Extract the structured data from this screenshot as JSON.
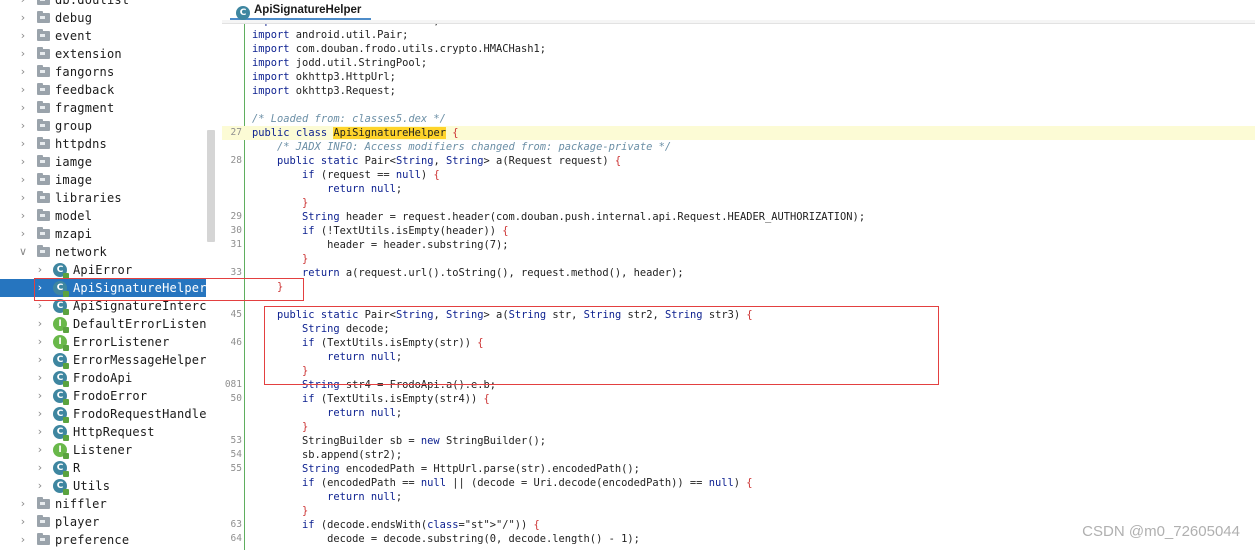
{
  "tree": {
    "items": [
      {
        "label": "db.doulist",
        "type": "package",
        "expand": "collapsed",
        "depth": 0
      },
      {
        "label": "debug",
        "type": "package",
        "expand": "collapsed",
        "depth": 0
      },
      {
        "label": "event",
        "type": "package",
        "expand": "collapsed",
        "depth": 0
      },
      {
        "label": "extension",
        "type": "package",
        "expand": "collapsed",
        "depth": 0
      },
      {
        "label": "fangorns",
        "type": "package",
        "expand": "collapsed",
        "depth": 0
      },
      {
        "label": "feedback",
        "type": "package",
        "expand": "collapsed",
        "depth": 0
      },
      {
        "label": "fragment",
        "type": "package",
        "expand": "collapsed",
        "depth": 0
      },
      {
        "label": "group",
        "type": "package",
        "expand": "collapsed",
        "depth": 0
      },
      {
        "label": "httpdns",
        "type": "package",
        "expand": "collapsed",
        "depth": 0
      },
      {
        "label": "iamge",
        "type": "package",
        "expand": "collapsed",
        "depth": 0
      },
      {
        "label": "image",
        "type": "package",
        "expand": "collapsed",
        "depth": 0
      },
      {
        "label": "libraries",
        "type": "package",
        "expand": "collapsed",
        "depth": 0
      },
      {
        "label": "model",
        "type": "package",
        "expand": "collapsed",
        "depth": 0
      },
      {
        "label": "mzapi",
        "type": "package",
        "expand": "collapsed",
        "depth": 0
      },
      {
        "label": "network",
        "type": "package",
        "expand": "expanded",
        "depth": 0
      },
      {
        "label": "ApiError",
        "type": "class",
        "expand": "collapsed",
        "depth": 1
      },
      {
        "label": "ApiSignatureHelper",
        "type": "class",
        "expand": "collapsed",
        "depth": 1,
        "selected": true
      },
      {
        "label": "ApiSignatureInterce",
        "type": "class",
        "expand": "collapsed",
        "depth": 1
      },
      {
        "label": "DefaultErrorListene",
        "type": "interface",
        "expand": "collapsed",
        "depth": 1
      },
      {
        "label": "ErrorListener",
        "type": "interface",
        "expand": "collapsed",
        "depth": 1
      },
      {
        "label": "ErrorMessageHelper",
        "type": "class",
        "expand": "collapsed",
        "depth": 1
      },
      {
        "label": "FrodoApi",
        "type": "class",
        "expand": "collapsed",
        "depth": 1
      },
      {
        "label": "FrodoError",
        "type": "class",
        "expand": "collapsed",
        "depth": 1
      },
      {
        "label": "FrodoRequestHandler",
        "type": "class",
        "expand": "collapsed",
        "depth": 1
      },
      {
        "label": "HttpRequest",
        "type": "class",
        "expand": "collapsed",
        "depth": 1
      },
      {
        "label": "Listener",
        "type": "interface",
        "expand": "collapsed",
        "depth": 1
      },
      {
        "label": "R",
        "type": "class",
        "expand": "collapsed",
        "depth": 1
      },
      {
        "label": "Utils",
        "type": "class",
        "expand": "collapsed",
        "depth": 1
      },
      {
        "label": "niffler",
        "type": "package",
        "expand": "collapsed",
        "depth": 0
      },
      {
        "label": "player",
        "type": "package",
        "expand": "collapsed",
        "depth": 0
      },
      {
        "label": "preference",
        "type": "package",
        "expand": "collapsed",
        "depth": 0
      }
    ]
  },
  "editor": {
    "tab_label": "ApiSignatureHelper",
    "class_icon_letter": "C",
    "interface_icon_letter": "I",
    "lines": [
      {
        "num": "",
        "text": "import android.text.TextUtils;",
        "type": "import"
      },
      {
        "num": "",
        "text": "import android.util.Pair;",
        "type": "import"
      },
      {
        "num": "",
        "text": "import com.douban.frodo.utils.crypto.HMACHash1;",
        "type": "import"
      },
      {
        "num": "",
        "text": "import jodd.util.StringPool;",
        "type": "import"
      },
      {
        "num": "",
        "text": "import okhttp3.HttpUrl;",
        "type": "import"
      },
      {
        "num": "",
        "text": "import okhttp3.Request;",
        "type": "import"
      },
      {
        "num": "",
        "text": "",
        "type": "blank"
      },
      {
        "num": "",
        "text": "/* Loaded from: classes5.dex */",
        "type": "comment"
      },
      {
        "num": "27",
        "text": "public class ApiSignatureHelper {",
        "type": "classdecl"
      },
      {
        "num": "",
        "text": "    /* JADX INFO: Access modifiers changed from: package-private */",
        "type": "comment"
      },
      {
        "num": "28",
        "text": "    public static Pair<String, String> a(Request request) {",
        "type": "code"
      },
      {
        "num": "",
        "text": "        if (request == null) {",
        "type": "code"
      },
      {
        "num": "",
        "text": "            return null;",
        "type": "code"
      },
      {
        "num": "",
        "text": "        }",
        "type": "code"
      },
      {
        "num": "29",
        "text": "        String header = request.header(com.douban.push.internal.api.Request.HEADER_AUTHORIZATION);",
        "type": "code"
      },
      {
        "num": "30",
        "text": "        if (!TextUtils.isEmpty(header)) {",
        "type": "code"
      },
      {
        "num": "31",
        "text": "            header = header.substring(7);",
        "type": "code"
      },
      {
        "num": "",
        "text": "        }",
        "type": "code"
      },
      {
        "num": "33",
        "text": "        return a(request.url().toString(), request.method(), header);",
        "type": "code"
      },
      {
        "num": "",
        "text": "    }",
        "type": "code"
      },
      {
        "num": "",
        "text": "",
        "type": "blank"
      },
      {
        "num": "45",
        "text": "    public static Pair<String, String> a(String str, String str2, String str3) {",
        "type": "code"
      },
      {
        "num": "",
        "text": "        String decode;",
        "type": "code"
      },
      {
        "num": "46",
        "text": "        if (TextUtils.isEmpty(str)) {",
        "type": "code"
      },
      {
        "num": "",
        "text": "            return null;",
        "type": "code"
      },
      {
        "num": "",
        "text": "        }",
        "type": "code"
      },
      {
        "num": "081",
        "text": "        String str4 = FrodoApi.a().e.b;",
        "type": "code"
      },
      {
        "num": "50",
        "text": "        if (TextUtils.isEmpty(str4)) {",
        "type": "code"
      },
      {
        "num": "",
        "text": "            return null;",
        "type": "code"
      },
      {
        "num": "",
        "text": "        }",
        "type": "code"
      },
      {
        "num": "53",
        "text": "        StringBuilder sb = new StringBuilder();",
        "type": "code"
      },
      {
        "num": "54",
        "text": "        sb.append(str2);",
        "type": "code"
      },
      {
        "num": "55",
        "text": "        String encodedPath = HttpUrl.parse(str).encodedPath();",
        "type": "code"
      },
      {
        "num": "",
        "text": "        if (encodedPath == null || (decode = Uri.decode(encodedPath)) == null) {",
        "type": "code"
      },
      {
        "num": "",
        "text": "            return null;",
        "type": "code"
      },
      {
        "num": "",
        "text": "        }",
        "type": "code"
      },
      {
        "num": "63",
        "text": "        if (decode.endsWith(\"/\")) {",
        "type": "code"
      },
      {
        "num": "64",
        "text": "            decode = decode.substring(0, decode.length() - 1);",
        "type": "code"
      }
    ]
  },
  "watermark": "CSDN @m0_72605044",
  "colors": {
    "selection": "#2675bf",
    "annotation_red": "#e34040",
    "line_highlight": "#fcfbd5",
    "name_highlight": "#ffd42a",
    "keyword": "#0b1f8f",
    "comment": "#6b8fa6"
  }
}
